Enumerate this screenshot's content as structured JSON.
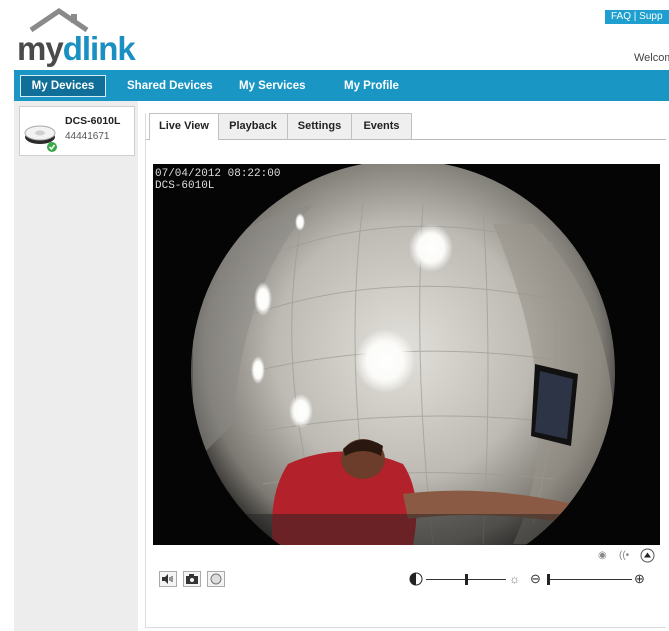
{
  "header": {
    "logo": {
      "prefix": "my",
      "accent": "dlink"
    },
    "faq_link": "FAQ | Supp",
    "welcome": "Welcom"
  },
  "nav": {
    "items": [
      {
        "label": "My Devices",
        "active": true
      },
      {
        "label": "Shared Devices"
      },
      {
        "label": "My Services"
      },
      {
        "label": "My Profile"
      }
    ]
  },
  "devices": [
    {
      "name": "DCS-6010L",
      "id": "44441671",
      "status": "online",
      "icon": "camera-icon"
    }
  ],
  "tabs": [
    {
      "label": "Live View",
      "active": true
    },
    {
      "label": "Playback"
    },
    {
      "label": "Settings"
    },
    {
      "label": "Events"
    }
  ],
  "video": {
    "timestamp": "07/04/2012 08:22:00",
    "camera_label": "DCS-6010L"
  },
  "controls": {
    "left_buttons": [
      "speaker-icon",
      "snapshot-icon",
      "record-icon"
    ],
    "top_right_icons": [
      "dot-icon",
      "broadcast-icon",
      "eject-icon"
    ],
    "brightness_icon": "contrast-icon",
    "brightness_level": 0.5,
    "zoom_level": 0.0
  },
  "colors": {
    "nav_bg": "#1a96c5",
    "nav_active": "#0f6f98",
    "accent": "#1a8fc2",
    "status_ok": "#3aa84a"
  }
}
